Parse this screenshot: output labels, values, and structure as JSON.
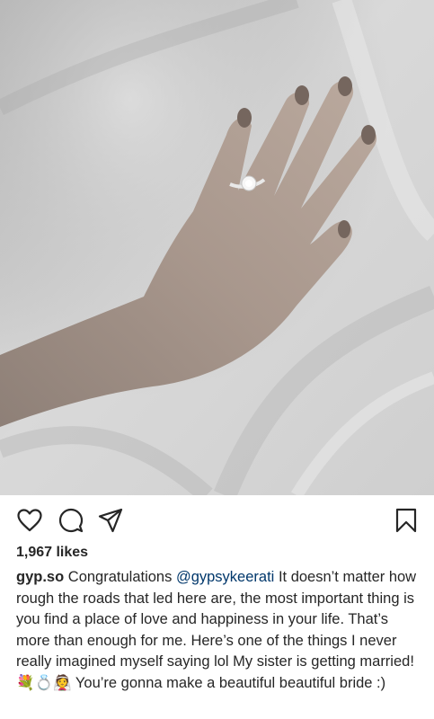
{
  "post": {
    "photo_alt": "",
    "likes_text": "1,967 likes",
    "username": "gyp.so",
    "caption_prefix": "Congratulations",
    "mention": "@gypsykeerati",
    "caption_body": "It doesn’t matter how rough the roads that led here are, the most important thing is you find a place of love and happiness in your life. That’s more than enough for me. Here’s one of the things I never really imagined myself saying lol My sister is getting married! 💐💍👰 You’re gonna make a beautiful beautiful bride :)"
  },
  "icons": {
    "like": "heart-outline-icon",
    "comment": "comment-bubble-icon",
    "share": "paper-plane-icon",
    "save": "bookmark-icon"
  },
  "colors": {
    "text": "#262626",
    "mention": "#00376b",
    "background": "#ffffff"
  }
}
